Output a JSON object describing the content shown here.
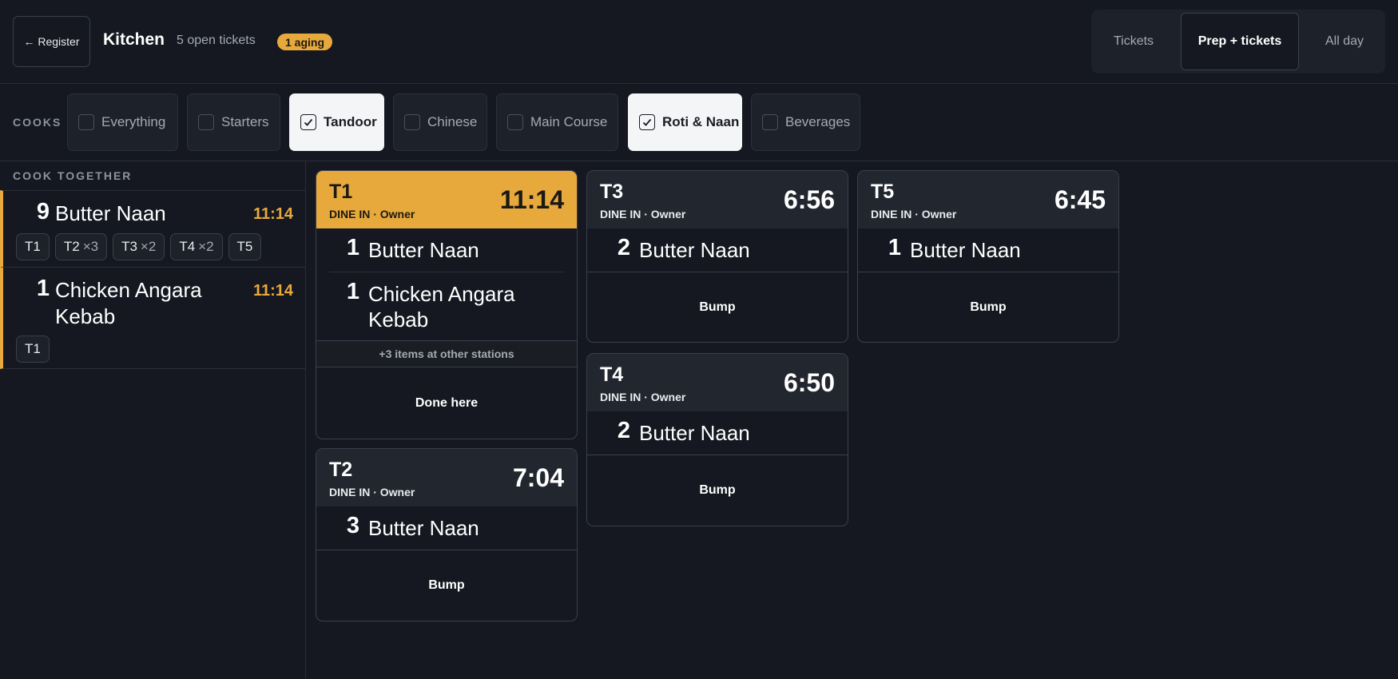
{
  "header": {
    "register_label": "← Register",
    "title": "Kitchen",
    "open_tickets": "5 open tickets",
    "aging_badge": "1 aging",
    "view_tabs": [
      {
        "label": "Tickets",
        "active": false
      },
      {
        "label": "Prep + tickets",
        "active": true
      },
      {
        "label": "All day",
        "active": false
      }
    ]
  },
  "stations": {
    "label": "COOKS",
    "items": [
      {
        "label": "Everything",
        "checked": false
      },
      {
        "label": "Starters",
        "checked": false
      },
      {
        "label": "Tandoor",
        "checked": true
      },
      {
        "label": "Chinese",
        "checked": false
      },
      {
        "label": "Main Course",
        "checked": false
      },
      {
        "label": "Roti & Naan",
        "checked": true
      },
      {
        "label": "Beverages",
        "checked": false
      }
    ]
  },
  "cook_together": {
    "label": "COOK TOGETHER",
    "items": [
      {
        "qty": "9",
        "name": "Butter Naan",
        "time": "11:14",
        "tickets": [
          {
            "table": "T1",
            "mult": ""
          },
          {
            "table": "T2",
            "mult": "×3"
          },
          {
            "table": "T3",
            "mult": "×2"
          },
          {
            "table": "T4",
            "mult": "×2"
          },
          {
            "table": "T5",
            "mult": ""
          }
        ]
      },
      {
        "qty": "1",
        "name": "Chicken Angara Kebab",
        "time": "11:14",
        "tickets": [
          {
            "table": "T1",
            "mult": ""
          }
        ]
      }
    ]
  },
  "tickets": [
    {
      "table": "T1",
      "subtitle": "DINE IN · Owner",
      "timer": "11:14",
      "aging": true,
      "lines": [
        {
          "qty": "1",
          "name": "Butter Naan"
        },
        {
          "qty": "1",
          "name": "Chicken Angara Kebab"
        }
      ],
      "other_stations": "+3 items at other stations",
      "action": "Done here"
    },
    {
      "table": "T3",
      "subtitle": "DINE IN · Owner",
      "timer": "6:56",
      "aging": false,
      "lines": [
        {
          "qty": "2",
          "name": "Butter Naan"
        }
      ],
      "action": "Bump"
    },
    {
      "table": "T5",
      "subtitle": "DINE IN · Owner",
      "timer": "6:45",
      "aging": false,
      "lines": [
        {
          "qty": "1",
          "name": "Butter Naan"
        }
      ],
      "action": "Bump"
    },
    {
      "table": "T4",
      "subtitle": "DINE IN · Owner",
      "timer": "6:50",
      "aging": false,
      "lines": [
        {
          "qty": "2",
          "name": "Butter Naan"
        }
      ],
      "action": "Bump"
    },
    {
      "table": "T2",
      "subtitle": "DINE IN · Owner",
      "timer": "7:04",
      "aging": false,
      "lines": [
        {
          "qty": "3",
          "name": "Butter Naan"
        }
      ],
      "action": "Bump"
    }
  ],
  "colors": {
    "background": "#151820",
    "accent_aging": "#e8a93c",
    "card_header": "#22262f",
    "border": "#3a3f4a"
  }
}
